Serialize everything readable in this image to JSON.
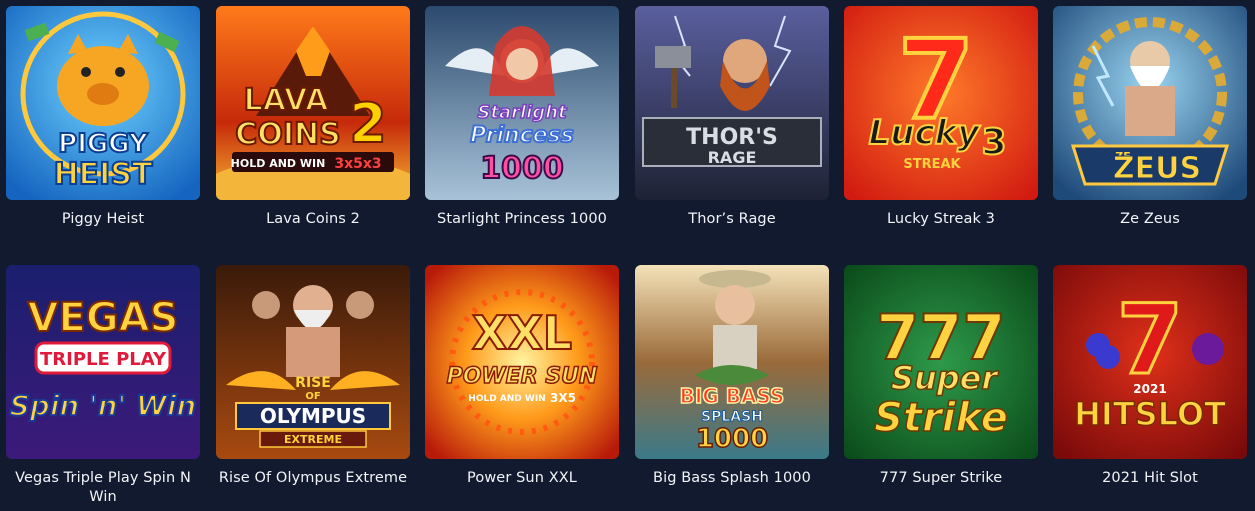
{
  "games": [
    {
      "title": "Piggy Heist",
      "logo_lines": [
        "PIGGY",
        "HEIST"
      ]
    },
    {
      "title": "Lava Coins 2",
      "logo_lines": [
        "LAVA",
        "COINS",
        "2",
        "HOLD AND WIN",
        "3x5x3"
      ]
    },
    {
      "title": "Starlight Princess 1000",
      "logo_lines": [
        "Starlight",
        "Princess",
        "1000"
      ]
    },
    {
      "title": "Thor’s Rage",
      "logo_lines": [
        "THOR'S",
        "RAGE"
      ]
    },
    {
      "title": "Lucky Streak 3",
      "logo_lines": [
        "7",
        "Lucky",
        "STREAK",
        "3"
      ]
    },
    {
      "title": "Ze Zeus",
      "logo_lines": [
        "ZE",
        "ZEUS"
      ]
    },
    {
      "title": "Vegas Triple Play Spin N Win",
      "logo_lines": [
        "VEGAS",
        "TRIPLE PLAY",
        "Spin 'n' Win"
      ]
    },
    {
      "title": "Rise Of Olympus Extreme",
      "logo_lines": [
        "RISE",
        "OF",
        "OLYMPUS",
        "EXTREME"
      ]
    },
    {
      "title": "Power Sun XXL",
      "logo_lines": [
        "XXL",
        "POWER SUN",
        "HOLD AND WIN",
        "3X5"
      ]
    },
    {
      "title": "Big Bass Splash 1000",
      "logo_lines": [
        "BIG BASS",
        "SPLASH",
        "1000"
      ]
    },
    {
      "title": "777 Super Strike",
      "logo_lines": [
        "777",
        "Super",
        "Strike"
      ]
    },
    {
      "title": "2021 Hit Slot",
      "logo_lines": [
        "7",
        "2021",
        "HITSLOT"
      ]
    }
  ]
}
